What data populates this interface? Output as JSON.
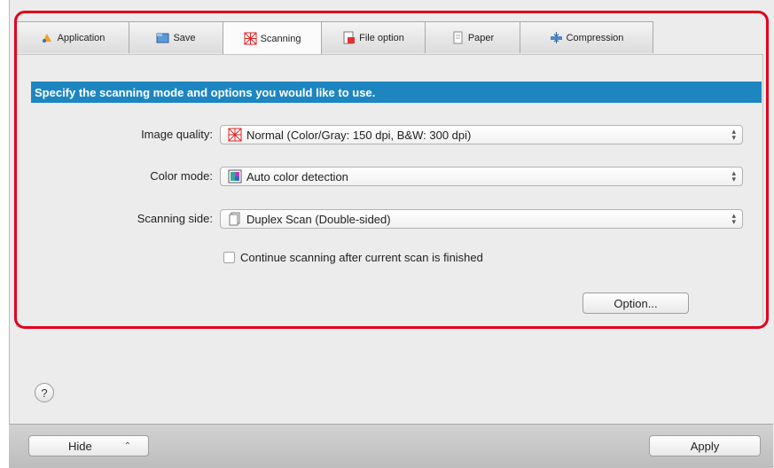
{
  "tabs": [
    {
      "label": "Application",
      "icon": "application-icon",
      "active": false
    },
    {
      "label": "Save",
      "icon": "save-icon",
      "active": false
    },
    {
      "label": "Scanning",
      "icon": "scanning-icon",
      "active": true
    },
    {
      "label": "File option",
      "icon": "file-option-icon",
      "active": false
    },
    {
      "label": "Paper",
      "icon": "paper-icon",
      "active": false
    },
    {
      "label": "Compression",
      "icon": "compression-icon",
      "active": false
    }
  ],
  "banner": "Specify the scanning mode and options you would like to use.",
  "fields": {
    "image_quality": {
      "label": "Image quality:",
      "value": "Normal (Color/Gray: 150 dpi, B&W: 300 dpi)"
    },
    "color_mode": {
      "label": "Color mode:",
      "value": "Auto color detection"
    },
    "scanning_side": {
      "label": "Scanning side:",
      "value": "Duplex Scan (Double-sided)"
    }
  },
  "continue_checkbox": {
    "label": "Continue scanning after current scan is finished",
    "checked": false
  },
  "option_button": "Option...",
  "help_button": "?",
  "hide_button": "Hide",
  "apply_button": "Apply",
  "colors": {
    "banner": "#1d86c1",
    "highlight": "#e2001a"
  }
}
